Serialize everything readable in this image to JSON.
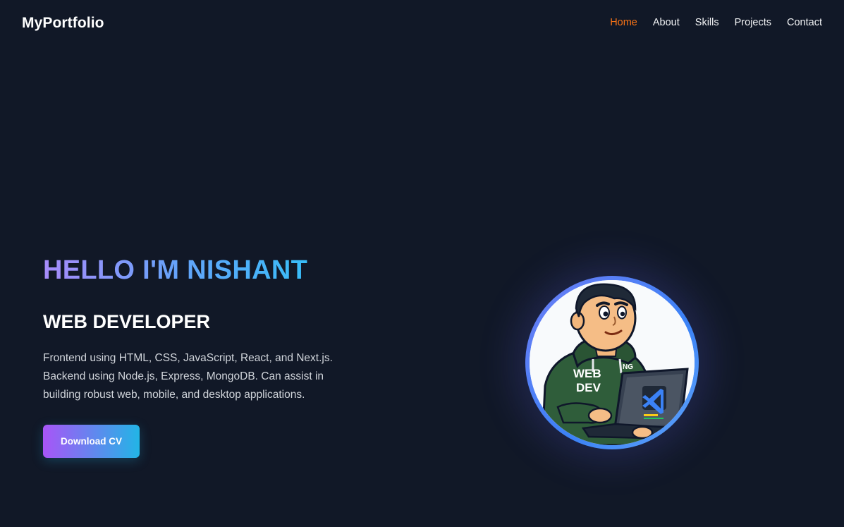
{
  "brand": {
    "name": "MyPortfolio"
  },
  "nav": {
    "items": [
      {
        "label": "Home"
      },
      {
        "label": "About"
      },
      {
        "label": "Skills"
      },
      {
        "label": "Projects"
      },
      {
        "label": "Contact"
      }
    ],
    "active_color": "#f97316"
  },
  "hero": {
    "title": "HELLO I'M NISHANT",
    "subtitle": "WEB DEVELOPER",
    "description_lines": [
      "Frontend using HTML, CSS, JavaScript, React, and Next.js.",
      "Backend using Node.js, Express, MongoDB. Can assist in",
      "building robust web, mobile, and desktop applications."
    ],
    "cta_label": "Download CV"
  },
  "avatar": {
    "hoodie_text_line1": "WEB",
    "hoodie_text_line2": "DEV",
    "hoodie_badge": "NG",
    "laptop_icon": "vscode-icon"
  },
  "colors": {
    "background": "#111827",
    "title_gradient_start": "#a78bfa",
    "title_gradient_end": "#38bdf8",
    "button_gradient_start": "#a855f7",
    "button_gradient_end": "#22b5e6",
    "avatar_ring": "#3b82f6"
  }
}
